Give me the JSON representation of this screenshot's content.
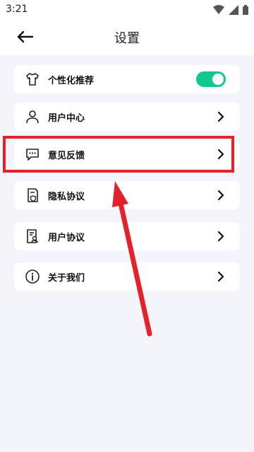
{
  "status_bar": {
    "time": "3:21"
  },
  "header": {
    "title": "设置"
  },
  "settings": {
    "items": [
      {
        "label": "个性化推荐",
        "icon": "tshirt-icon",
        "control": "toggle",
        "toggle_on": true
      },
      {
        "label": "用户中心",
        "icon": "user-icon",
        "control": "chevron"
      },
      {
        "label": "意见反馈",
        "icon": "feedback-message-icon",
        "control": "chevron"
      },
      {
        "label": "隐私协议",
        "icon": "privacy-document-icon",
        "control": "chevron"
      },
      {
        "label": "用户协议",
        "icon": "user-agreement-icon",
        "control": "chevron"
      },
      {
        "label": "关于我们",
        "icon": "info-icon",
        "control": "chevron"
      }
    ]
  },
  "colors": {
    "accent_toggle": "#11c98f",
    "annotation_red": "#e3232b",
    "background": "#f4f5fa"
  }
}
